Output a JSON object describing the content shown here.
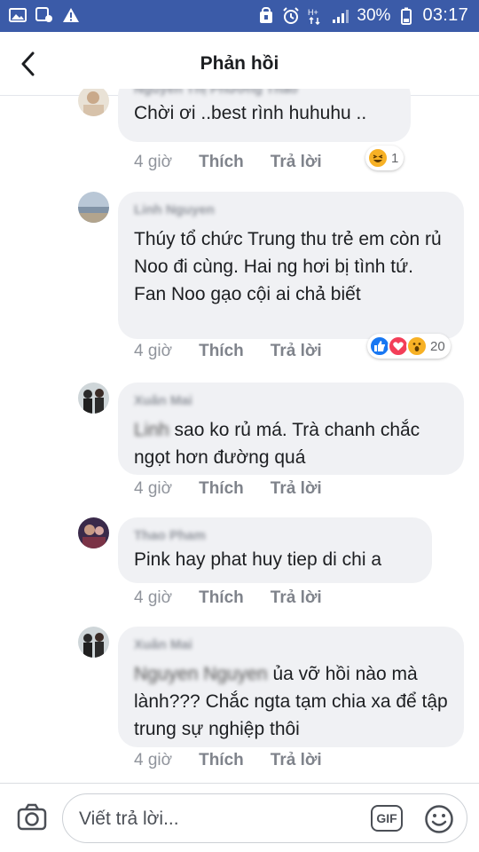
{
  "status_bar": {
    "battery_percent": "30%",
    "time": "03:17",
    "left_icons": [
      "image-icon",
      "messenger-icon",
      "alert-icon"
    ],
    "right_icons": [
      "nfc-icon",
      "alarm-icon",
      "data-icon",
      "signal-icon",
      "battery-icon"
    ]
  },
  "header": {
    "title": "Phản hồi",
    "back_icon": "chevron-left-icon"
  },
  "comments": [
    {
      "author": "Nguyễn Thị Phương Thảo",
      "text_parts": [
        "Chời ơi ..best rình huhuhu .."
      ],
      "time": "4 giờ",
      "like_label": "Thích",
      "reply_label": "Trả lời",
      "reactions": {
        "icons": [
          "haha"
        ],
        "count": "1"
      }
    },
    {
      "author": "Linh Nguyen",
      "text": "Thúy tổ chức Trung thu trẻ em còn rủ Noo đi cùng. Hai ng hơi bị tình tứ.  Fan Noo gạo cội ai chả biết",
      "time": "4 giờ",
      "like_label": "Thích",
      "reply_label": "Trả lời",
      "reactions": {
        "icons": [
          "like",
          "love",
          "wow"
        ],
        "count": "20"
      }
    },
    {
      "author": "Xuân Mai",
      "mention": "Linh",
      "text": "sao ko rủ má. Trà chanh chắc ngọt hơn đường quá",
      "time": "4 giờ",
      "like_label": "Thích",
      "reply_label": "Trả lời"
    },
    {
      "author": "Thao Pham",
      "text": "Pink hay phat huy tiep di chi a",
      "time": "4 giờ",
      "like_label": "Thích",
      "reply_label": "Trả lời"
    },
    {
      "author": "Xuân Mai",
      "mention": "Nguyen Nguyen",
      "text": "ủa vỡ hồi nào mà lành??? Chắc ngta tạm chia xa để tập trung sự nghiệp thôi",
      "time": "4 giờ",
      "like_label": "Thích",
      "reply_label": "Trả lời"
    }
  ],
  "reply_bar": {
    "placeholder": "Viết trả lời...",
    "gif_label": "GIF",
    "camera_icon": "camera-icon",
    "emoji_icon": "emoji-icon"
  },
  "colors": {
    "status_bar": "#3b5ba8",
    "bubble": "#f0f1f4",
    "meta_text": "#90949c",
    "like_blue": "#1877f2",
    "love_red": "#f33e58",
    "wow_yellow": "#f7b125"
  }
}
